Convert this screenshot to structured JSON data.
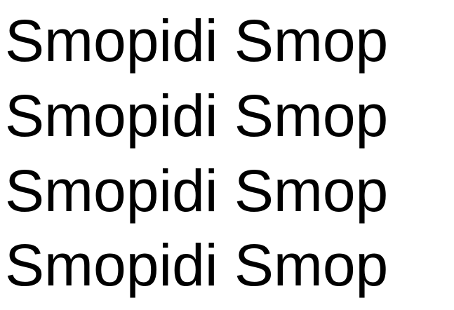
{
  "lines": [
    "Smopidi Smop",
    "Smopidi Smop",
    "Smopidi Smop",
    "Smopidi Smop"
  ],
  "colors": {
    "background": "#ffffff",
    "text": "#000000"
  }
}
